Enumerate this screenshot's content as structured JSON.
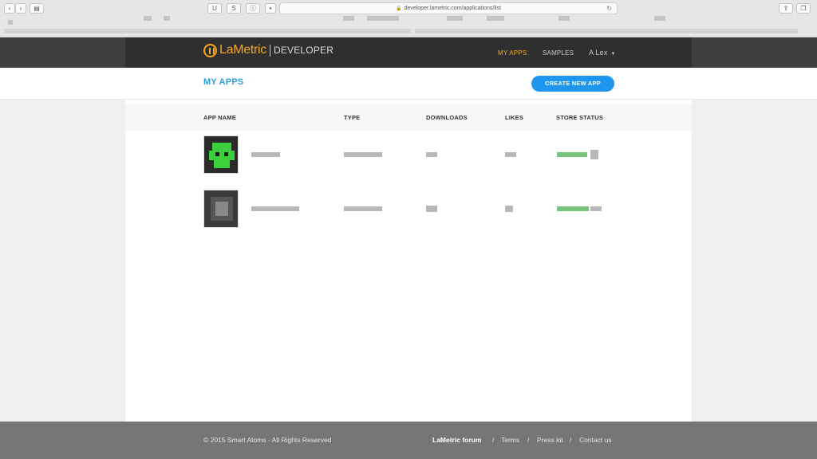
{
  "browser": {
    "url": "developer.lametric.com/applications/list",
    "back_icon": "chevron-left-icon",
    "forward_icon": "chevron-right-icon",
    "sidebar_icon": "sidebar-icon",
    "ext_u_label": "U",
    "ext_s_label": "S",
    "ext_info_label": "ⓘ"
  },
  "header": {
    "logo_text": "LaMetric",
    "logo_suffix": "DEVELOPER",
    "nav": [
      {
        "label": "MY APPS",
        "active": true
      },
      {
        "label": "SAMPLES",
        "active": false
      }
    ],
    "user": "A Lex"
  },
  "page": {
    "title": "MY APPS",
    "create_button": "CREATE NEW APP"
  },
  "table": {
    "columns": [
      "APP NAME",
      "TYPE",
      "DOWNLOADS",
      "LIKES",
      "STORE STATUS"
    ],
    "rows": [
      {
        "icon": "green-pixel-app-icon"
      },
      {
        "icon": "grey-pixel-app-icon"
      }
    ]
  },
  "footer": {
    "copyright": "© 2015 Smart Atoms - All Rights Reserved",
    "links": [
      "LaMetric forum",
      "Terms",
      "Press kit",
      "Contact us"
    ],
    "separator": "/"
  },
  "colors": {
    "accent": "#f5a623",
    "primary_blue": "#1e96f0",
    "title_blue": "#2d9cdb",
    "header_bg": "#2f2f2f",
    "footer_bg": "#767676"
  }
}
